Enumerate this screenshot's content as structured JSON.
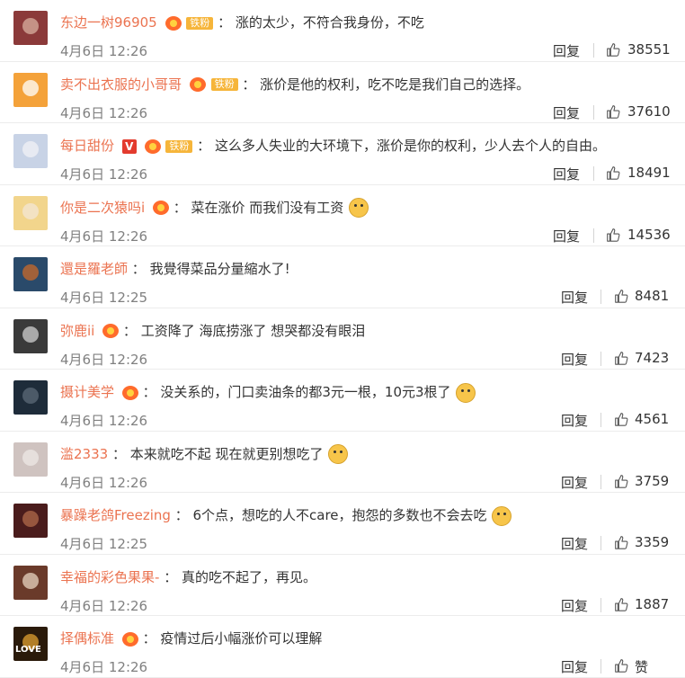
{
  "comments": [
    {
      "user": "东边一树96905",
      "badge": true,
      "fan_label": "铁粉",
      "vip": false,
      "text": "涨的太少，不符合我身份，不吃",
      "emoji": false,
      "time": "4月6日 12:26",
      "reply": "回复",
      "likes": "38551",
      "avatar_colors": [
        "#8b3a3a",
        "#d8b0a0"
      ]
    },
    {
      "user": "卖不出衣服的小哥哥",
      "badge": true,
      "fan_label": "铁粉",
      "vip": false,
      "text": "涨价是他的权利，吃不吃是我们自己的选择。",
      "emoji": false,
      "time": "4月6日 12:26",
      "reply": "回复",
      "likes": "37610",
      "avatar_colors": [
        "#f4a23a",
        "#ffffff"
      ]
    },
    {
      "user": "每日甜份",
      "badge": true,
      "fan_label": "铁粉",
      "vip": true,
      "vip_label": "V",
      "text": "这么多人失业的大环境下，涨价是你的权利，少人去个人的自由。",
      "emoji": false,
      "time": "4月6日 12:26",
      "reply": "回复",
      "likes": "18491",
      "avatar_colors": [
        "#c8d3e6",
        "#f1f1f5"
      ]
    },
    {
      "user": "你是二次猿吗i",
      "badge": true,
      "fan_label": "",
      "vip": false,
      "text": "菜在涨价 而我们没有工资",
      "emoji": true,
      "time": "4月6日 12:26",
      "reply": "回复",
      "likes": "14536",
      "avatar_colors": [
        "#f2d58c",
        "#f3e5d6"
      ]
    },
    {
      "user": "還是羅老師",
      "badge": false,
      "fan_label": "",
      "vip": false,
      "text": "我覺得菜品分量縮水了!",
      "emoji": false,
      "time": "4月6日 12:25",
      "reply": "回复",
      "likes": "8481",
      "avatar_colors": [
        "#2a4a6a",
        "#c96a2a"
      ]
    },
    {
      "user": "弥鹿ii",
      "badge": true,
      "fan_label": "",
      "vip": false,
      "text": "工资降了 海底捞涨了 想哭都没有眼泪",
      "emoji": false,
      "time": "4月6日 12:26",
      "reply": "回复",
      "likes": "7423",
      "avatar_colors": [
        "#3a3a3a",
        "#d0d0d0"
      ]
    },
    {
      "user": "摄计美学",
      "badge": true,
      "fan_label": "",
      "vip": false,
      "text": "没关系的，门口卖油条的都3元一根，10元3根了",
      "emoji": true,
      "time": "4月6日 12:26",
      "reply": "回复",
      "likes": "4561",
      "avatar_colors": [
        "#1e2c3a",
        "#5c6a78"
      ]
    },
    {
      "user": "滥2333",
      "badge": false,
      "fan_label": "",
      "vip": false,
      "text": "本来就吃不起 现在就更别想吃了",
      "emoji": true,
      "time": "4月6日 12:26",
      "reply": "回复",
      "likes": "3759",
      "avatar_colors": [
        "#cfc3c0",
        "#eee8e6"
      ]
    },
    {
      "user": "暴躁老鸽Freezing",
      "badge": false,
      "fan_label": "",
      "vip": false,
      "text": "6个点，想吃的人不care，抱怨的多数也不会去吃",
      "emoji": true,
      "time": "4月6日 12:25",
      "reply": "回复",
      "likes": "3359",
      "avatar_colors": [
        "#4a1c1c",
        "#b06a4a"
      ]
    },
    {
      "user": "幸福的彩色果果-",
      "badge": false,
      "fan_label": "",
      "vip": false,
      "text": "真的吃不起了，再见。",
      "emoji": false,
      "time": "4月6日 12:26",
      "reply": "回复",
      "likes": "1887",
      "avatar_colors": [
        "#6a3a2a",
        "#e8d4c0"
      ]
    },
    {
      "user": "择偶标准",
      "badge": true,
      "fan_label": "",
      "vip": false,
      "text": "疫情过后小幅涨价可以理解",
      "emoji": false,
      "time": "4月6日 12:26",
      "reply": "回复",
      "likes": "赞",
      "avatar_colors": [
        "#2a1a0a",
        "#e0a030"
      ],
      "avatar_text": "LOVE"
    }
  ]
}
